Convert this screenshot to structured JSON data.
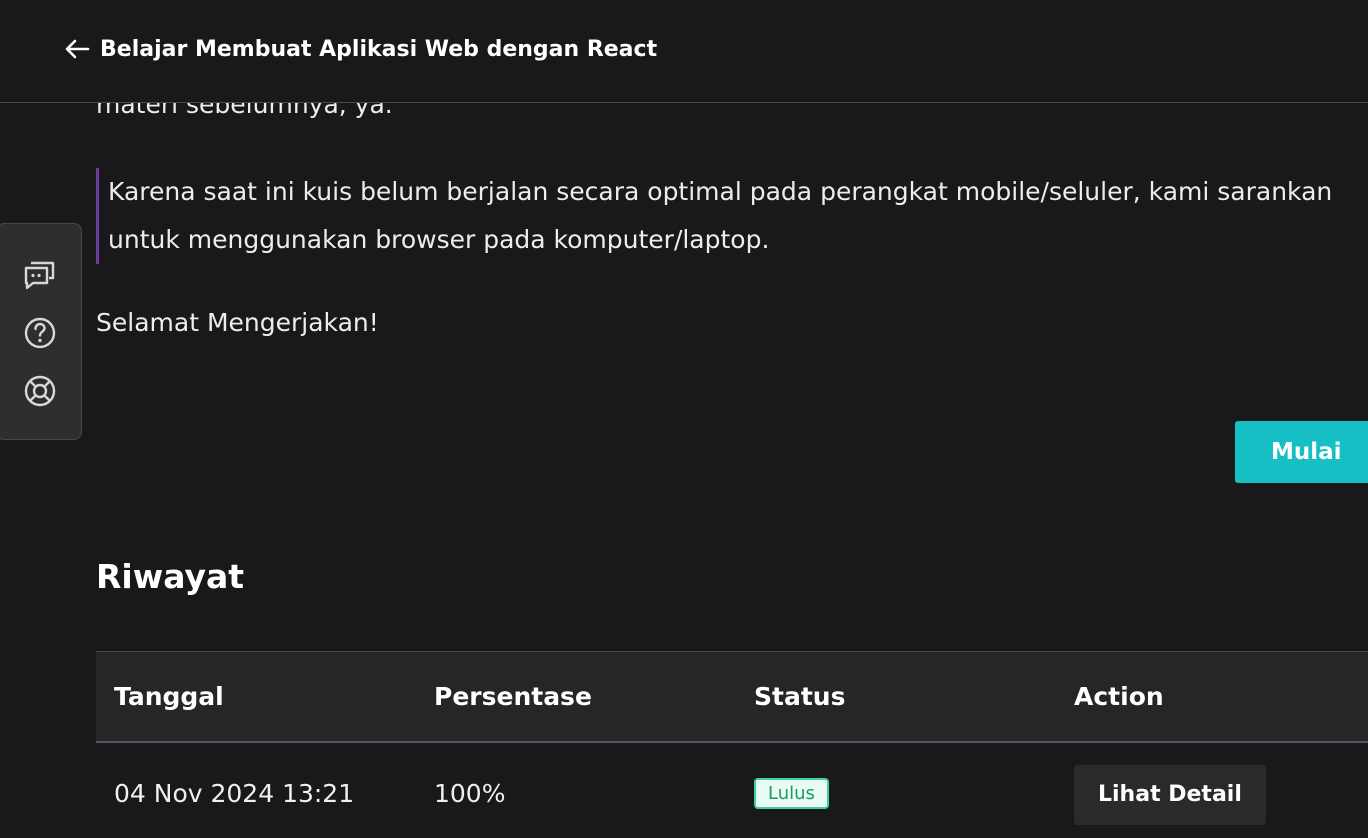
{
  "header": {
    "back_icon": "arrow-left-icon",
    "course_title": "Belajar Membuat Aplikasi Web dengan React"
  },
  "content": {
    "cut_text": "materi sebelumnya, ya.",
    "notice": "Karena saat ini kuis belum berjalan secara optimal pada perangkat mobile/seluler, kami sarankan untuk menggunakan browser pada komputer/laptop.",
    "greeting": "Selamat Mengerjakan!",
    "start_button": "Mulai"
  },
  "history": {
    "title": "Riwayat",
    "columns": [
      "Tanggal",
      "Persentase",
      "Status",
      "Action"
    ],
    "rows": [
      {
        "date": "04 Nov 2024 13:21",
        "percentage": "100%",
        "status": "Lulus",
        "action": "Lihat Detail"
      }
    ]
  },
  "side_tools": {
    "icons": [
      "chat-icon",
      "help-icon",
      "lifebuoy-icon"
    ]
  },
  "colors": {
    "background": "#19191b",
    "accent": "#16bfc4",
    "notice_border": "#6a3fa0",
    "status_pass": "#3fd19a"
  }
}
